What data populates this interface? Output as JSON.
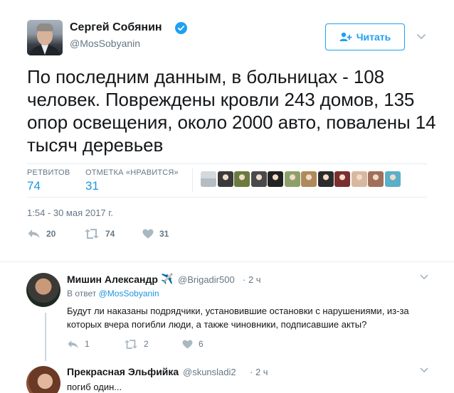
{
  "tweet": {
    "author_name": "Сергей Собянин",
    "author_handle": "@MosSobyanin",
    "follow_label": "Читать",
    "text": "По последним данным, в больницах - 108 человек. Повреждены кровли 243 домов, 135 опор освещения, около 2000 авто, повалены 14 тысяч деревьев",
    "retweets_label": "РЕТВИТОВ",
    "retweets_count": "74",
    "likes_label": "ОТМЕТКА «НРАВИТСЯ»",
    "likes_count": "31",
    "timestamp": "1:54 - 30 мая 2017 г.",
    "actions": {
      "reply_count": "20",
      "retweet_count": "74",
      "like_count": "31"
    },
    "liker_avatars": [
      {
        "name": "liker-avatar-1",
        "color": "#b5bcc2"
      },
      {
        "name": "liker-avatar-2",
        "color": "#3a3a3a"
      },
      {
        "name": "liker-avatar-3",
        "color": "#6b7a3e"
      },
      {
        "name": "liker-avatar-4",
        "color": "#4a4a4a"
      },
      {
        "name": "liker-avatar-5",
        "color": "#222222"
      },
      {
        "name": "liker-avatar-6",
        "color": "#8da06a"
      },
      {
        "name": "liker-avatar-7",
        "color": "#b08a5a"
      },
      {
        "name": "liker-avatar-8",
        "color": "#2b2b2b"
      },
      {
        "name": "liker-avatar-9",
        "color": "#7a2e2e"
      },
      {
        "name": "liker-avatar-10",
        "color": "#d9b8a0"
      },
      {
        "name": "liker-avatar-11",
        "color": "#a06f5a"
      },
      {
        "name": "liker-avatar-12",
        "color": "#5ab0c8"
      }
    ]
  },
  "replies": [
    {
      "name": "Мишин Александр",
      "name_emoji": "✈️",
      "handle": "@Brigadir500",
      "time": "· 2 ч",
      "reply_to_prefix": "В ответ",
      "reply_to_handle": "@MosSobyanin",
      "text": "Будут ли наказаны подрядчики, установившие остановки с нарушениями, из-за которых вчера погибли люди, а также чиновники, подписавшие акты?",
      "reply_count": "1",
      "retweet_count": "2",
      "like_count": "6"
    },
    {
      "name": "Прекрасная Эльфийка",
      "handle": "@skunsladi2",
      "time": "· 2 ч",
      "text": "погиб один..."
    }
  ],
  "colors": {
    "accent": "#1da1f2",
    "link": "#1b95e0",
    "muted": "#657786",
    "border": "#e6ecf0"
  },
  "icons": {
    "verified": "verified-badge-icon",
    "follow": "add-user-icon",
    "more": "chevron-down-icon",
    "reply": "reply-icon",
    "retweet": "retweet-icon",
    "like": "heart-icon"
  }
}
